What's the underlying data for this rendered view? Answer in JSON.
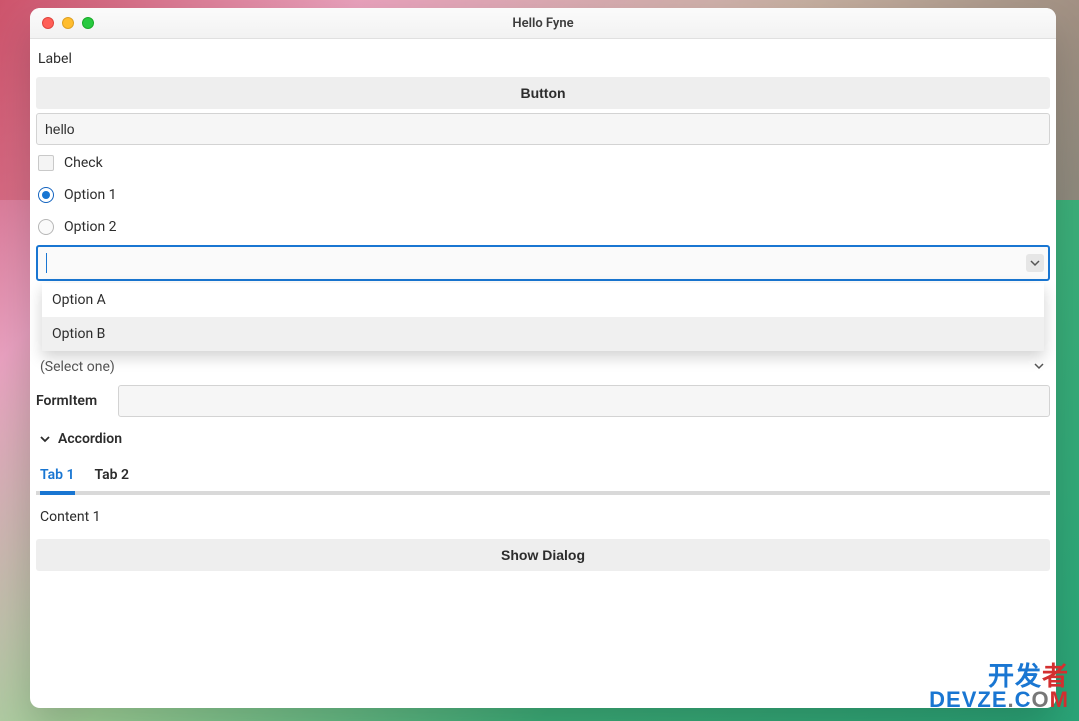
{
  "window": {
    "title": "Hello Fyne"
  },
  "label": {
    "text": "Label"
  },
  "button": {
    "label": "Button"
  },
  "entry": {
    "value": "hello"
  },
  "check": {
    "label": "Check",
    "checked": false
  },
  "radios": {
    "options": [
      {
        "label": "Option 1",
        "selected": true
      },
      {
        "label": "Option 2",
        "selected": false
      }
    ]
  },
  "combo": {
    "value": "",
    "dropdown": [
      {
        "label": "Option A"
      },
      {
        "label": "Option B"
      }
    ]
  },
  "select": {
    "placeholder": "(Select one)"
  },
  "form": {
    "item_label": "FormItem",
    "item_value": ""
  },
  "accordion": {
    "title": "Accordion"
  },
  "tabs": {
    "items": [
      {
        "label": "Tab 1",
        "active": true
      },
      {
        "label": "Tab 2",
        "active": false
      }
    ],
    "content": "Content 1"
  },
  "dialog_button": {
    "label": "Show Dialog"
  },
  "watermark": {
    "line1_pre": "开发",
    "line1_red": "者",
    "line2_dev": "DEV",
    "line2_z": "Z",
    "line2_e": "E",
    "line2_dot": ".",
    "line2_c": "C",
    "line2_o": "O",
    "line2_m": "M"
  }
}
